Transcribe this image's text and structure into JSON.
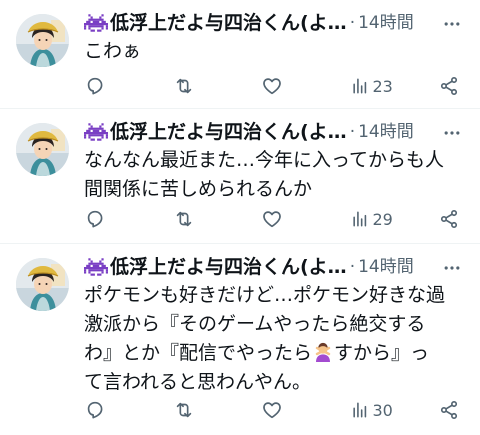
{
  "tweets": [
    {
      "author": "低浮上だよ与四治くん(よ…",
      "dot": "·",
      "time": "14時間",
      "text_lines": [
        "こわぁ"
      ],
      "reply_count": "",
      "retweet_count": "",
      "like_count": "",
      "views": "23"
    },
    {
      "author": "低浮上だよ与四治くん(よ…",
      "dot": "·",
      "time": "14時間",
      "text_lines": [
        "なんなん最近また…今年に入ってからも人",
        "間関係に苦しめられるんか"
      ],
      "reply_count": "",
      "retweet_count": "",
      "like_count": "",
      "views": "29"
    },
    {
      "author": "低浮上だよ与四治くん(よ…",
      "dot": "·",
      "time": "14時間",
      "text_lines": [
        "ポケモンも好きだけど…ポケモン好きな過",
        "激派から『そのゲームやったら絶交する",
        "わ』とか『配信でやったら",
        "すから』っ",
        "て言われると思わんやん。"
      ],
      "reply_count": "",
      "retweet_count": "",
      "like_count": "",
      "views": "30"
    }
  ],
  "icons": {
    "name_icon": "space-invader-icon",
    "more": "more-dots-icon",
    "reply": "reply-icon",
    "retweet": "retweet-icon",
    "like": "heart-icon",
    "views": "views-icon",
    "share": "share-icon",
    "inline_emoji": "person-gesturing-no-emoji"
  },
  "colors": {
    "text": "#0f1419",
    "muted": "#536471",
    "name_icon": "#7a3fc4",
    "divider": "#eff3f4"
  }
}
